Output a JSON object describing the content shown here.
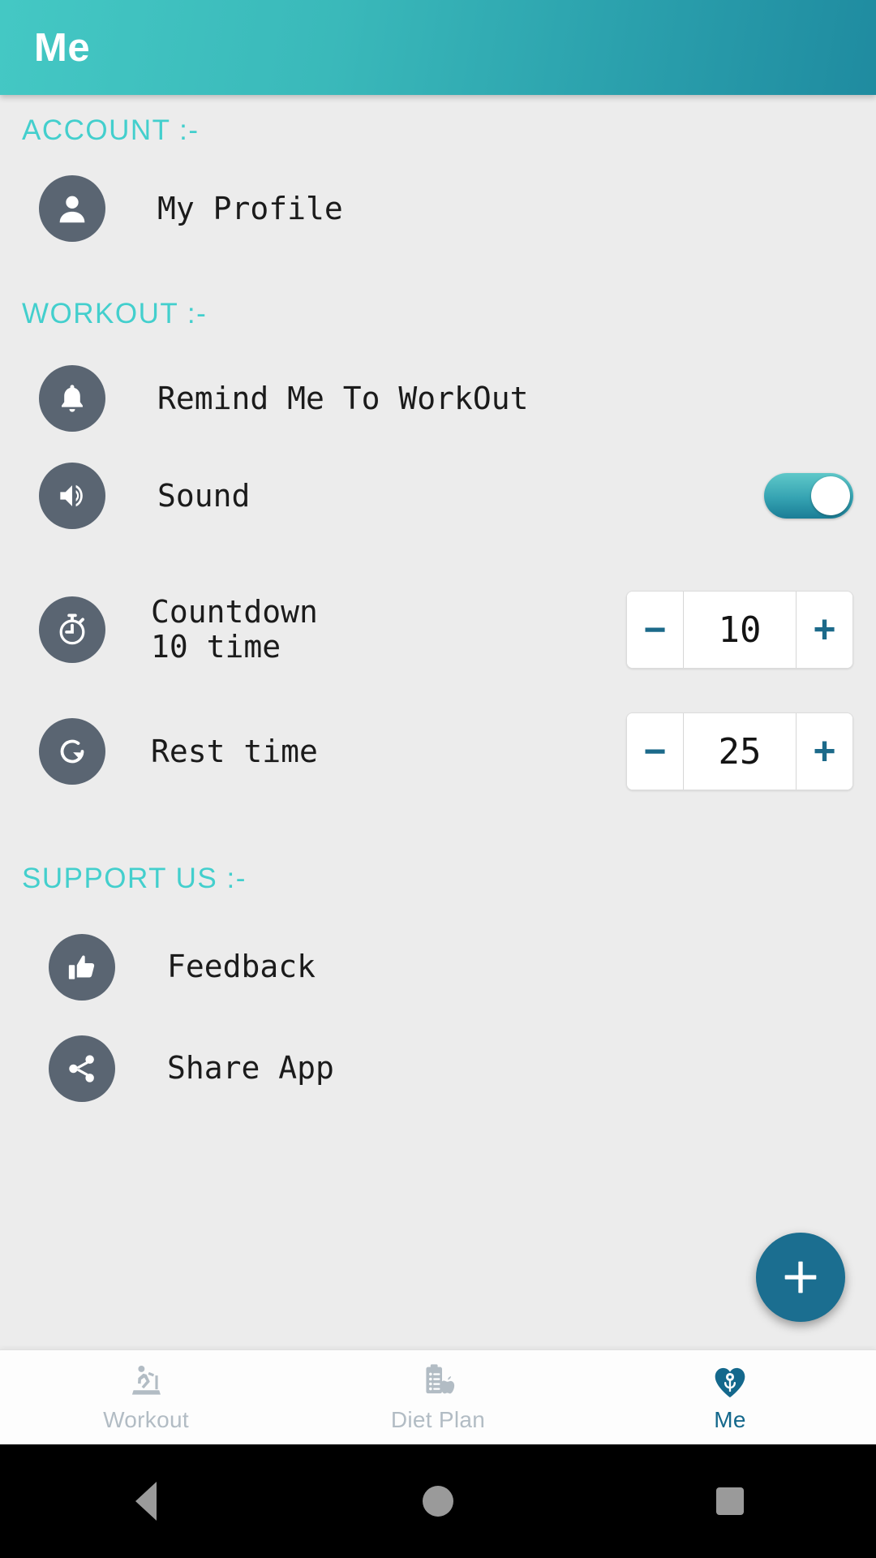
{
  "appbar": {
    "title": "Me"
  },
  "sections": {
    "account": {
      "title": "ACCOUNT  :-"
    },
    "workout": {
      "title": "WORKOUT  :-"
    },
    "support": {
      "title": "SUPPORT US  :-"
    }
  },
  "rows": {
    "profile": {
      "label": "My Profile",
      "icon": "person-icon"
    },
    "remind": {
      "label": "Remind Me To WorkOut",
      "icon": "bell-icon"
    },
    "sound": {
      "label": "Sound",
      "icon": "speaker-icon",
      "toggle_state": "on"
    },
    "countdown": {
      "label": "Countdown\n 10 time",
      "icon": "stopwatch-icon",
      "value": "10",
      "minus": "−",
      "plus": "+"
    },
    "rest": {
      "label": "Rest time",
      "icon": "refresh-icon",
      "value": "25",
      "minus": "−",
      "plus": "+"
    },
    "feedback": {
      "label": "Feedback",
      "icon": "thumbs-up-icon"
    },
    "share": {
      "label": "Share App",
      "icon": "share-icon"
    }
  },
  "fab": {
    "icon": "plus-icon"
  },
  "bottomnav": {
    "items": [
      {
        "label": "Workout",
        "icon": "treadmill-icon",
        "active": false
      },
      {
        "label": "Diet Plan",
        "icon": "clipboard-apple-icon",
        "active": false
      },
      {
        "label": "Me",
        "icon": "heart-person-icon",
        "active": true
      }
    ]
  },
  "sysbar": {
    "back": "back-icon",
    "home": "home-icon",
    "recents": "recents-icon"
  },
  "colors": {
    "header_gradient_start": "#44c8c4",
    "header_gradient_end": "#1f8ba0",
    "section_title": "#43cfcd",
    "icon_circle": "#5a6572",
    "accent_dark": "#1b6e90",
    "stepper_sign": "#1c6a8a",
    "nav_inactive": "#b2bcc4",
    "nav_active": "#14688c",
    "page_bg": "#ececec"
  }
}
